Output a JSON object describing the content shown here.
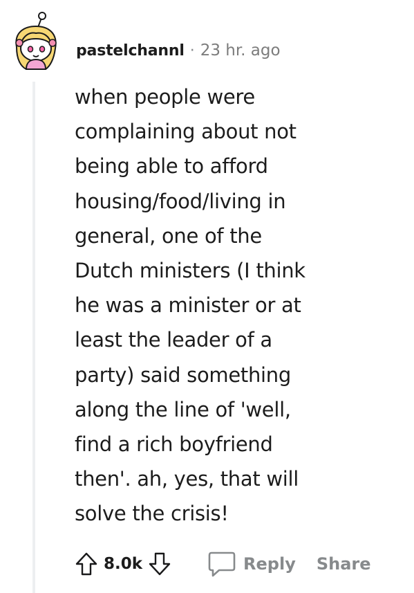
{
  "comment": {
    "username": "pastelchannl",
    "separator": "·",
    "time": "23 hr. ago",
    "body": "when people were complaining about not being able to afford housing/food/living in general, one of the Dutch ministers (I think he was a minister or at least the leader of a party) said something along the line of 'well, find a rich boyfriend then'. ah, yes, that will solve the crisis!",
    "body_lines": [
      "when people were",
      "complaining about not",
      "being able to afford",
      "housing/food/living in",
      "general, one of the",
      "Dutch ministers (I think",
      "he was a minister or at",
      "least the leader of a",
      "party) said something",
      "along the line of 'well,",
      "find a rich boyfriend",
      "then'. ah, yes, that will",
      "solve the crisis!"
    ]
  },
  "actions": {
    "upvote_icon": "upvote-arrow-icon",
    "vote_count": "8.0k",
    "downvote_icon": "downvote-arrow-icon",
    "reply_icon": "speech-bubble-icon",
    "reply_label": "Reply",
    "share_label": "Share"
  }
}
